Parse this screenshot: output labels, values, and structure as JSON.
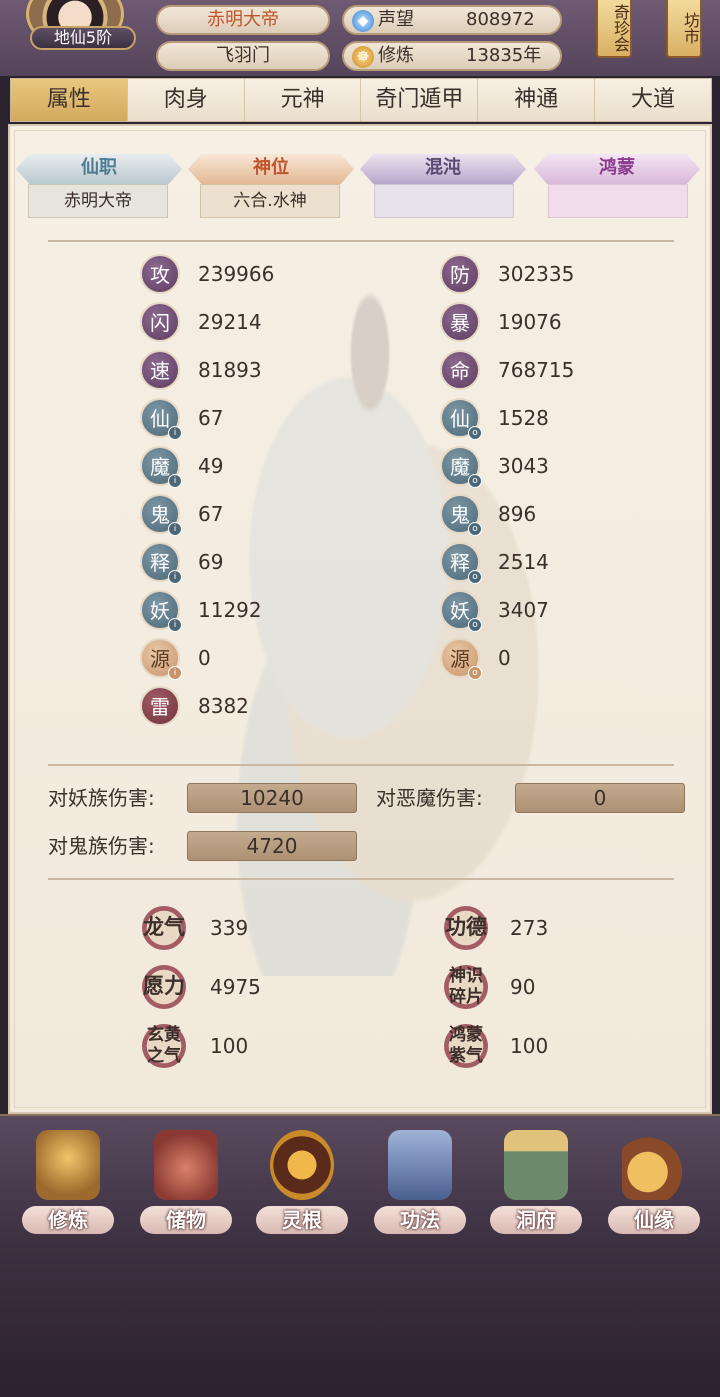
{
  "header": {
    "rank_badge": "地仙5阶",
    "title": "赤明大帝",
    "sect": "飞羽门",
    "reputation": {
      "label": "声望",
      "value": "808972",
      "icon": "crystal-icon"
    },
    "cultivation": {
      "label": "修炼",
      "value": "13835年",
      "icon": "meditation-icon"
    },
    "sign_treasure": "奇珍会",
    "sign_market": "坊市"
  },
  "tabs": [
    {
      "label": "属性",
      "active": true
    },
    {
      "label": "肉身",
      "active": false
    },
    {
      "label": "元神",
      "active": false
    },
    {
      "label": "奇门遁甲",
      "active": false
    },
    {
      "label": "神通",
      "active": false
    },
    {
      "label": "大道",
      "active": false
    }
  ],
  "ranks": [
    {
      "label": "仙职",
      "value": "赤明大帝"
    },
    {
      "label": "神位",
      "value": "六合.水神"
    },
    {
      "label": "混沌",
      "value": ""
    },
    {
      "label": "鸿蒙",
      "value": ""
    }
  ],
  "stats_left": [
    {
      "icon": "攻",
      "value": "239966",
      "style": "purple"
    },
    {
      "icon": "闪",
      "value": "29214",
      "style": "purple"
    },
    {
      "icon": "速",
      "value": "81893",
      "style": "purple"
    },
    {
      "icon": "仙",
      "value": "67",
      "style": "teal"
    },
    {
      "icon": "魔",
      "value": "49",
      "style": "teal"
    },
    {
      "icon": "鬼",
      "value": "67",
      "style": "teal"
    },
    {
      "icon": "释",
      "value": "69",
      "style": "teal"
    },
    {
      "icon": "妖",
      "value": "11292",
      "style": "teal"
    },
    {
      "icon": "源",
      "value": "0",
      "style": "orange"
    },
    {
      "icon": "雷",
      "value": "8382",
      "style": "red"
    }
  ],
  "stats_right": [
    {
      "icon": "防",
      "value": "302335",
      "style": "purple"
    },
    {
      "icon": "暴",
      "value": "19076",
      "style": "purple"
    },
    {
      "icon": "命",
      "value": "768715",
      "style": "purple"
    },
    {
      "icon": "仙",
      "value": "1528",
      "style": "teal"
    },
    {
      "icon": "魔",
      "value": "3043",
      "style": "teal"
    },
    {
      "icon": "鬼",
      "value": "896",
      "style": "teal"
    },
    {
      "icon": "释",
      "value": "2514",
      "style": "teal"
    },
    {
      "icon": "妖",
      "value": "3407",
      "style": "teal"
    },
    {
      "icon": "源",
      "value": "0",
      "style": "orange"
    }
  ],
  "damage": {
    "vs_yao_label": "对妖族伤害:",
    "vs_yao_value": "10240",
    "vs_emo_label": "对恶魔伤害:",
    "vs_emo_value": "0",
    "vs_gui_label": "对鬼族伤害:",
    "vs_gui_value": "4720"
  },
  "resources": {
    "longqi": {
      "label": "龙气",
      "value": "339"
    },
    "gongde": {
      "label": "功德",
      "value": "273"
    },
    "yuanli": {
      "label": "愿力",
      "value": "4975"
    },
    "shenshi": {
      "label": "神识碎片",
      "value": "90"
    },
    "xuanhuang": {
      "label": "玄黄之气",
      "value": "100"
    },
    "hongmeng": {
      "label": "鸿蒙紫气",
      "value": "100"
    }
  },
  "bottom_nav": [
    {
      "label": "修炼"
    },
    {
      "label": "储物"
    },
    {
      "label": "灵根"
    },
    {
      "label": "功法"
    },
    {
      "label": "洞府"
    },
    {
      "label": "仙缘"
    }
  ]
}
